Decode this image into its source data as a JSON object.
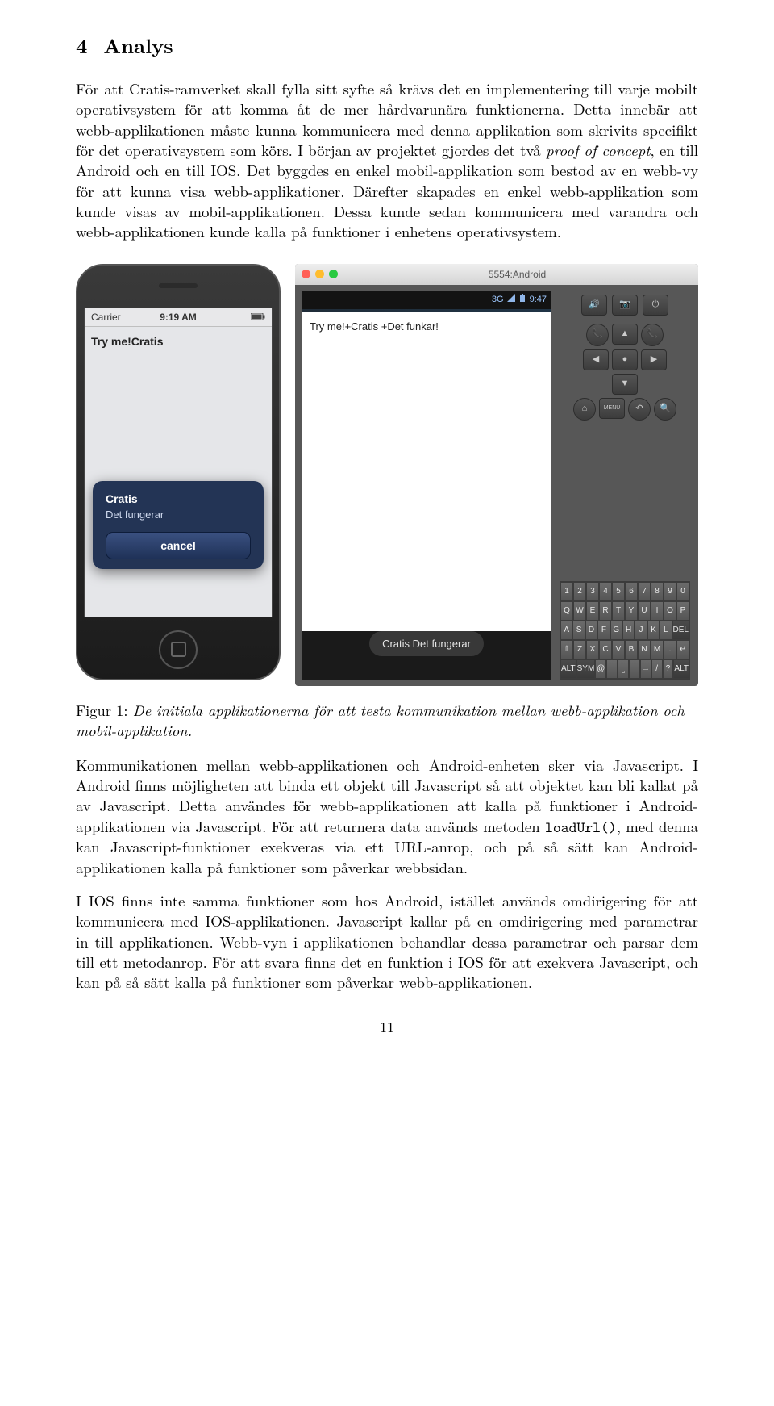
{
  "section": {
    "number": "4",
    "title": "Analys"
  },
  "paragraphs": {
    "p1a": "För att Cratis-ramverket skall fylla sitt syfte så krävs det en implementering till varje mobilt operativsystem för att komma åt de mer hårdvarunära funktionerna. Detta innebär att webb-applikationen måste kunna kommunicera med denna applikation som skrivits specifikt för det operativsystem som körs. I början av projektet gjordes det två ",
    "p1_poc": "proof of concept",
    "p1b": ", en till Android och en till IOS. Det byggdes en enkel mobil-applikation som bestod av en webb-vy för att kunna visa webb-applikationer. Därefter skapades en enkel webb-applikation som kunde visas av mobil-applikationen. Dessa kunde sedan kommunicera med varandra och webb-applikationen kunde kalla på funktioner i enhetens operativsystem.",
    "p2a": "Kommunikationen mellan webb-applikationen och Android-enheten sker via Javascript. I Android finns möjligheten att binda ett objekt till Javascript så att objektet kan bli kallat på av Javascript. Detta användes för webb-applikationen att kalla på funktioner i Android-applikationen via Javascript. För att returnera data används metoden ",
    "p2_code": "loadUrl()",
    "p2b": ", med denna kan Javascript-funktioner exekveras via ett URL-anrop, och på så sätt kan Android-applikationen kalla på funktioner som påverkar webbsidan.",
    "p3": "I IOS finns inte samma funktioner som hos Android, istället används omdirigering för att kommunicera med IOS-applikationen. Javascript kallar på en omdirigering med parametrar in till applikationen. Webb-vyn i applikationen behandlar dessa parametrar och parsar dem till ett metodanrop. För att svara finns det en funktion i IOS för att exekvera Javascript, och kan på så sätt kalla på funktioner som påverkar webb-applikationen."
  },
  "figure": {
    "label": "Figur 1:",
    "caption": "De initiala applikationerna för att testa kommunikation mellan webb-applikation och mobil-applikation."
  },
  "iphone": {
    "carrier": "Carrier",
    "time": "9:19 AM",
    "try_text": "Try me!Cratis",
    "alert_title": "Cratis",
    "alert_msg": "Det fungerar",
    "alert_cancel": "cancel"
  },
  "android": {
    "window_title": "5554:Android",
    "status_time": "9:47",
    "status_net": "3G",
    "try_text": "Try me!+Cratis +Det funkar!",
    "toast": "Cratis Det fungerar",
    "side_buttons": {
      "cam": "📷",
      "vol": "🔊",
      "pwr": "⏻",
      "call": "📞",
      "end": "📞",
      "home": "⌂",
      "menu": "MENU",
      "back": "↶",
      "search": "🔍"
    },
    "kbd_rows": [
      [
        "1",
        "2",
        "3",
        "4",
        "5",
        "6",
        "7",
        "8",
        "9",
        "0"
      ],
      [
        "Q",
        "W",
        "E",
        "R",
        "T",
        "Y",
        "U",
        "I",
        "O",
        "P"
      ],
      [
        "A",
        "S",
        "D",
        "F",
        "G",
        "H",
        "J",
        "K",
        "L",
        "DEL"
      ],
      [
        "⇧",
        "Z",
        "X",
        "C",
        "V",
        "B",
        "N",
        "M",
        ".",
        "↵"
      ],
      [
        "ALT",
        "SYM",
        "@",
        "",
        "⎵",
        "",
        "→",
        "/",
        "?",
        "ALT"
      ]
    ]
  },
  "page_number": "11"
}
